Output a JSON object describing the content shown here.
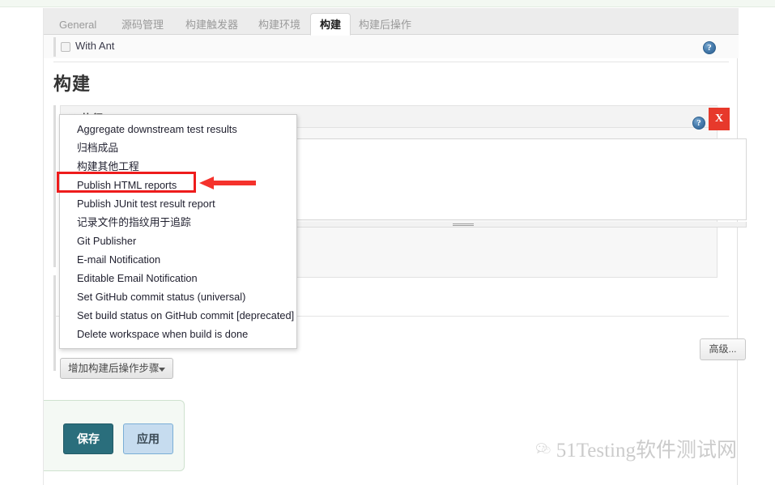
{
  "page": {
    "tabs": [
      {
        "label": "General",
        "active": false
      },
      {
        "label": "源码管理",
        "active": false
      },
      {
        "label": "构建触发器",
        "active": false
      },
      {
        "label": "构建环境",
        "active": false
      },
      {
        "label": "构建",
        "active": true
      },
      {
        "label": "构建后操作",
        "active": false
      }
    ],
    "build_env": {
      "with_ant_label": "With Ant",
      "help_icon": "help-icon"
    },
    "section_title": "构建",
    "build_step": {
      "title": "执行 shell",
      "remove_label": "X",
      "textarea_value": "",
      "advanced_label": "高级...",
      "help_icon": "help-icon",
      "drag_handle_icon": "drag-grip-icon"
    },
    "add_post_build_button": {
      "label": "增加构建后操作步骤",
      "caret_icon": "chevron-down-icon"
    },
    "dropdown": {
      "items": [
        "Aggregate downstream test results",
        "归档成品",
        "构建其他工程",
        "Publish HTML reports",
        "Publish JUnit test result report",
        "记录文件的指纹用于追踪",
        "Git Publisher",
        "E-mail Notification",
        "Editable Email Notification",
        "Set GitHub commit status (universal)",
        "Set build status on GitHub commit [deprecated]",
        "Delete workspace when build is done"
      ],
      "highlighted_item": "Publish HTML reports"
    },
    "footer_actions": {
      "save_label": "保存",
      "apply_label": "应用"
    },
    "annotation": {
      "highlight_color": "#ee1c1c",
      "arrow_color": "#f5322c",
      "arrow_icon": "left-arrow-icon"
    },
    "watermark": {
      "text": "51Testing软件测试网",
      "icon": "wechat-icon"
    },
    "colors": {
      "save_button": "#2a6e7c",
      "apply_button": "#c6dcef",
      "remove_button": "#e7392b",
      "panel_bg": "#f7f7f7",
      "top_band": "#f3f8f2"
    }
  }
}
